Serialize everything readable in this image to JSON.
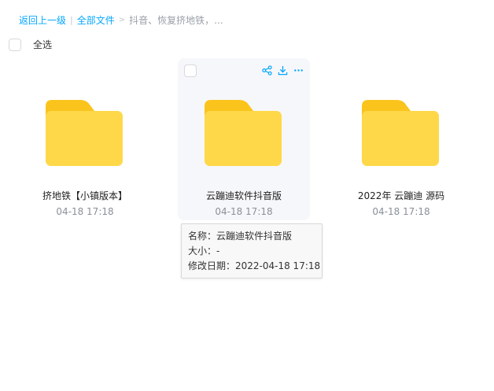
{
  "breadcrumb": {
    "back": "返回上一级",
    "sep_bar": "|",
    "all_files": "全部文件",
    "sep_arrow": ">",
    "current": "抖音、恢复挤地铁，..."
  },
  "select_all": {
    "label": "全选"
  },
  "colors": {
    "accent": "#06a7ff",
    "folder_front": "#ffd84a",
    "folder_back": "#fbc41c",
    "hover_bg": "#f6f7fa",
    "icon": "#06a7ff"
  },
  "files": [
    {
      "name": "挤地铁【小镇版本】",
      "time": "04-18 17:18",
      "icon": "folder-icon"
    },
    {
      "name": "云蹦迪软件抖音版",
      "time": "04-18 17:18",
      "icon": "folder-icon"
    },
    {
      "name": "2022年 云蹦迪 源码",
      "time": "04-18 17:18",
      "icon": "folder-icon"
    }
  ],
  "card_actions": [
    "share-icon",
    "download-icon",
    "more-icon"
  ],
  "tooltip": {
    "name_line": "名称：云蹦迪软件抖音版",
    "size_line": "大小：-",
    "modified_line": "修改日期：2022-04-18 17:18"
  }
}
